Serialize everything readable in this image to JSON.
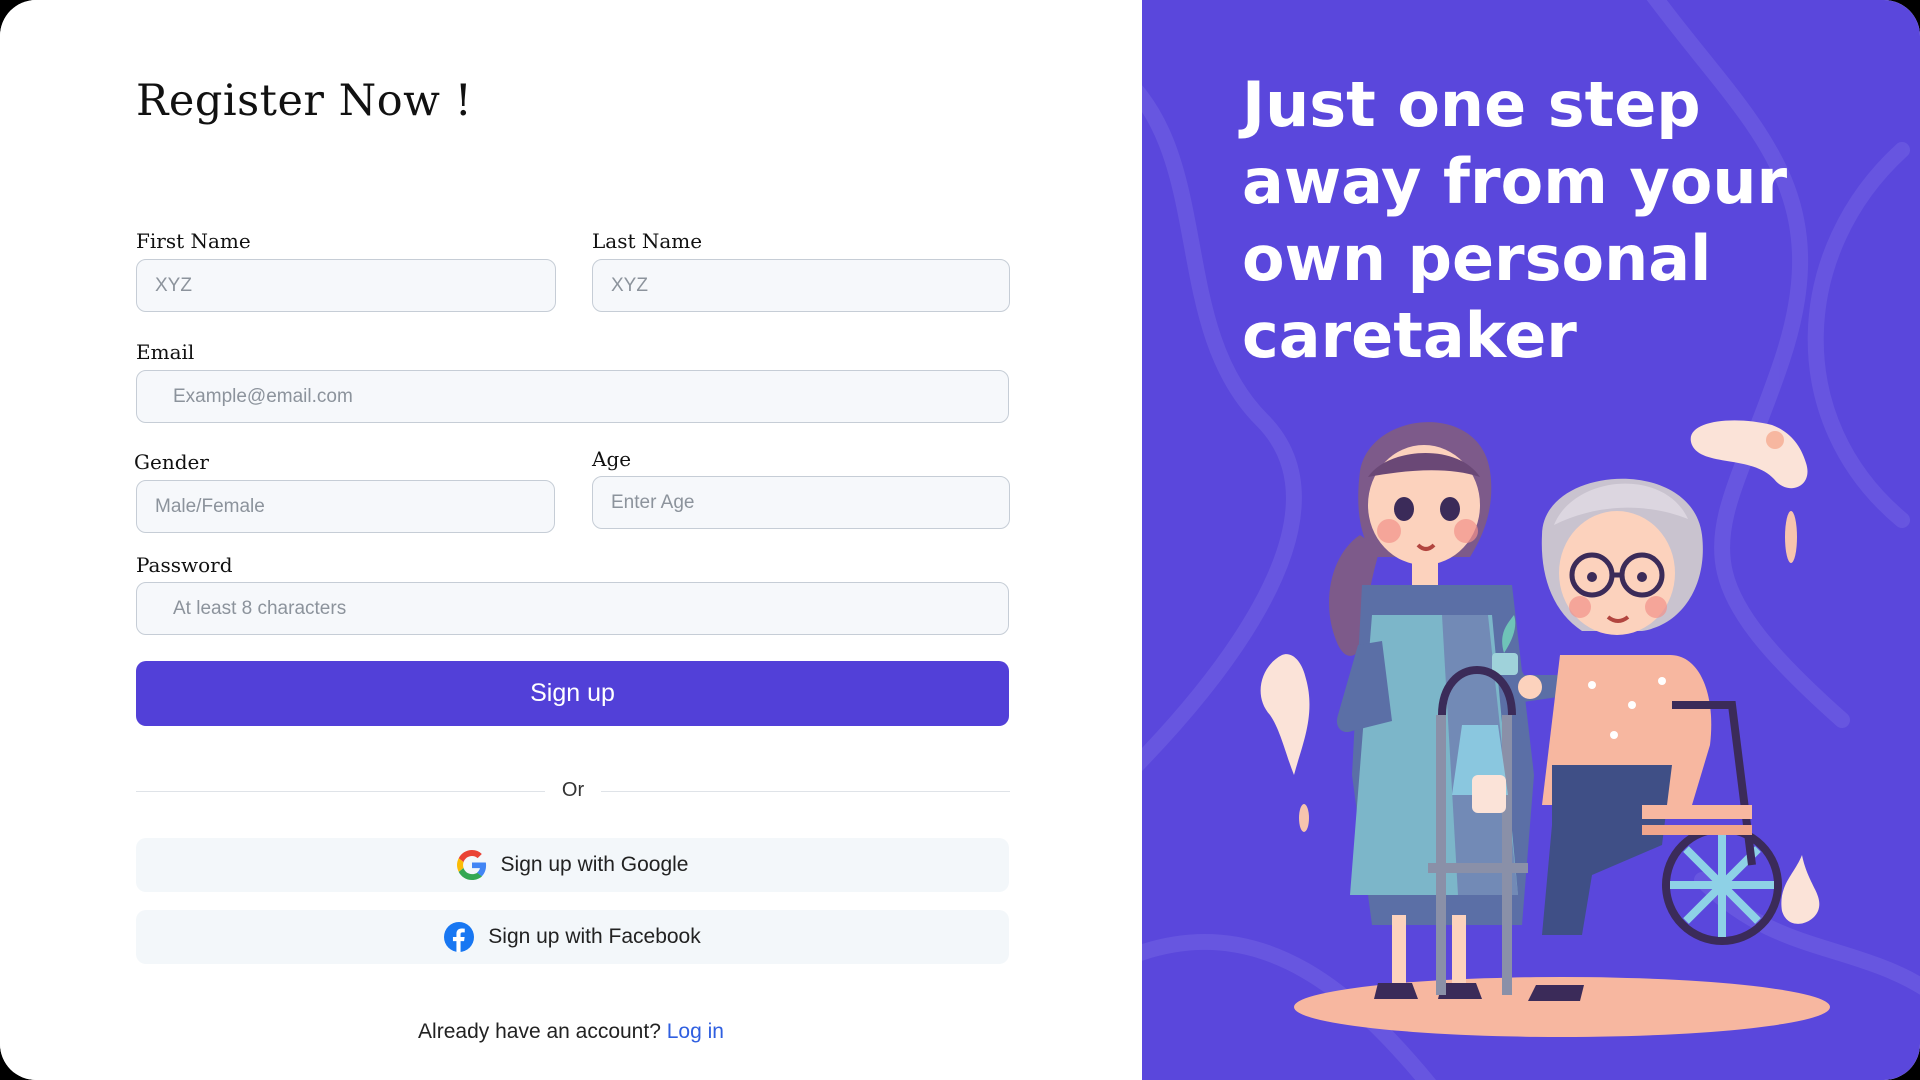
{
  "form": {
    "title": "Register Now !",
    "first_name": {
      "label": "First Name",
      "placeholder": "XYZ"
    },
    "last_name": {
      "label": "Last Name",
      "placeholder": "XYZ"
    },
    "email": {
      "label": "Email",
      "placeholder": "Example@email.com"
    },
    "gender": {
      "label": "Gender",
      "placeholder": "Male/Female"
    },
    "age": {
      "label": "Age",
      "placeholder": "Enter Age"
    },
    "password": {
      "label": "Password",
      "placeholder": "At least 8 characters"
    },
    "signup_label": "Sign up",
    "divider_text": "Or",
    "google_label": "Sign up with Google",
    "facebook_label": "Sign up with Facebook",
    "already_text": "Already have an account?",
    "login_label": "Log in"
  },
  "promo": {
    "headline": "Just one step\naway  from your\nown personal\ncaretaker"
  },
  "icons": {
    "google": "google-icon",
    "facebook": "facebook-icon",
    "illustration": "caretaker-illustration"
  },
  "colors": {
    "accent": "#5240d8",
    "promo_bg": "#5a47dc",
    "link": "#2f5fe0",
    "input_bg": "#f6f8fb",
    "input_border": "#c6cdd6"
  }
}
